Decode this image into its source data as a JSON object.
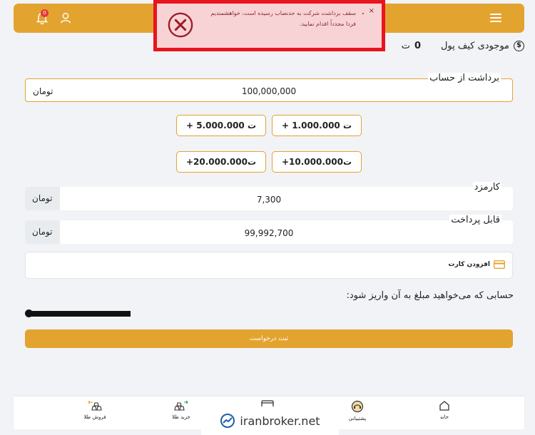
{
  "header": {
    "notification_count": "0",
    "menu_icon": "hamburger-icon",
    "user_icon": "user-icon",
    "bell_icon": "bell-icon"
  },
  "toast": {
    "message": "سقف برداشت شرکت به حدنصاب رسیده است، خواهشمندیم فردا مجدداً اقدام نمایید.",
    "close": "×",
    "icon": "error-circle-x-icon",
    "color": "#e8141e"
  },
  "wallet": {
    "label": "موجودی کیف پول",
    "amount": "0",
    "currency": "ت",
    "icon": "dollar-icon"
  },
  "withdraw": {
    "label": "برداشت از حساب",
    "value": "100,000,000",
    "unit": "تومان"
  },
  "quick_amounts": [
    {
      "label": "+ 1.000.000 ت"
    },
    {
      "label": "+ 5.000.000 ت"
    },
    {
      "label": "+10.000.000ت"
    },
    {
      "label": "+20.000.000ت"
    }
  ],
  "fee": {
    "label": "کارمزد",
    "value": "7,300",
    "unit": "تومان"
  },
  "payable": {
    "label": "قابل پرداخت",
    "value": "99,992,700",
    "unit": "تومان"
  },
  "card": {
    "add_label": "افزودن کارت",
    "icon": "credit-card-icon"
  },
  "destination": {
    "label": "حسابی که می‌خواهید مبلغ به آن واریز شود:"
  },
  "submit": {
    "label": "ثبت درخواست"
  },
  "bottom_nav": [
    {
      "label": "خانه",
      "icon": "home-icon"
    },
    {
      "label": "پشتیبانی",
      "icon": "support-icon"
    },
    {
      "label": "خرید طلا",
      "icon": "buy-gold-icon"
    },
    {
      "label": "فروش طلا",
      "icon": "sell-gold-icon"
    }
  ],
  "watermark": {
    "text": "iranbroker.net"
  },
  "colors": {
    "accent": "#e3a32f",
    "error": "#e8141e",
    "background": "#f1f3f6"
  }
}
